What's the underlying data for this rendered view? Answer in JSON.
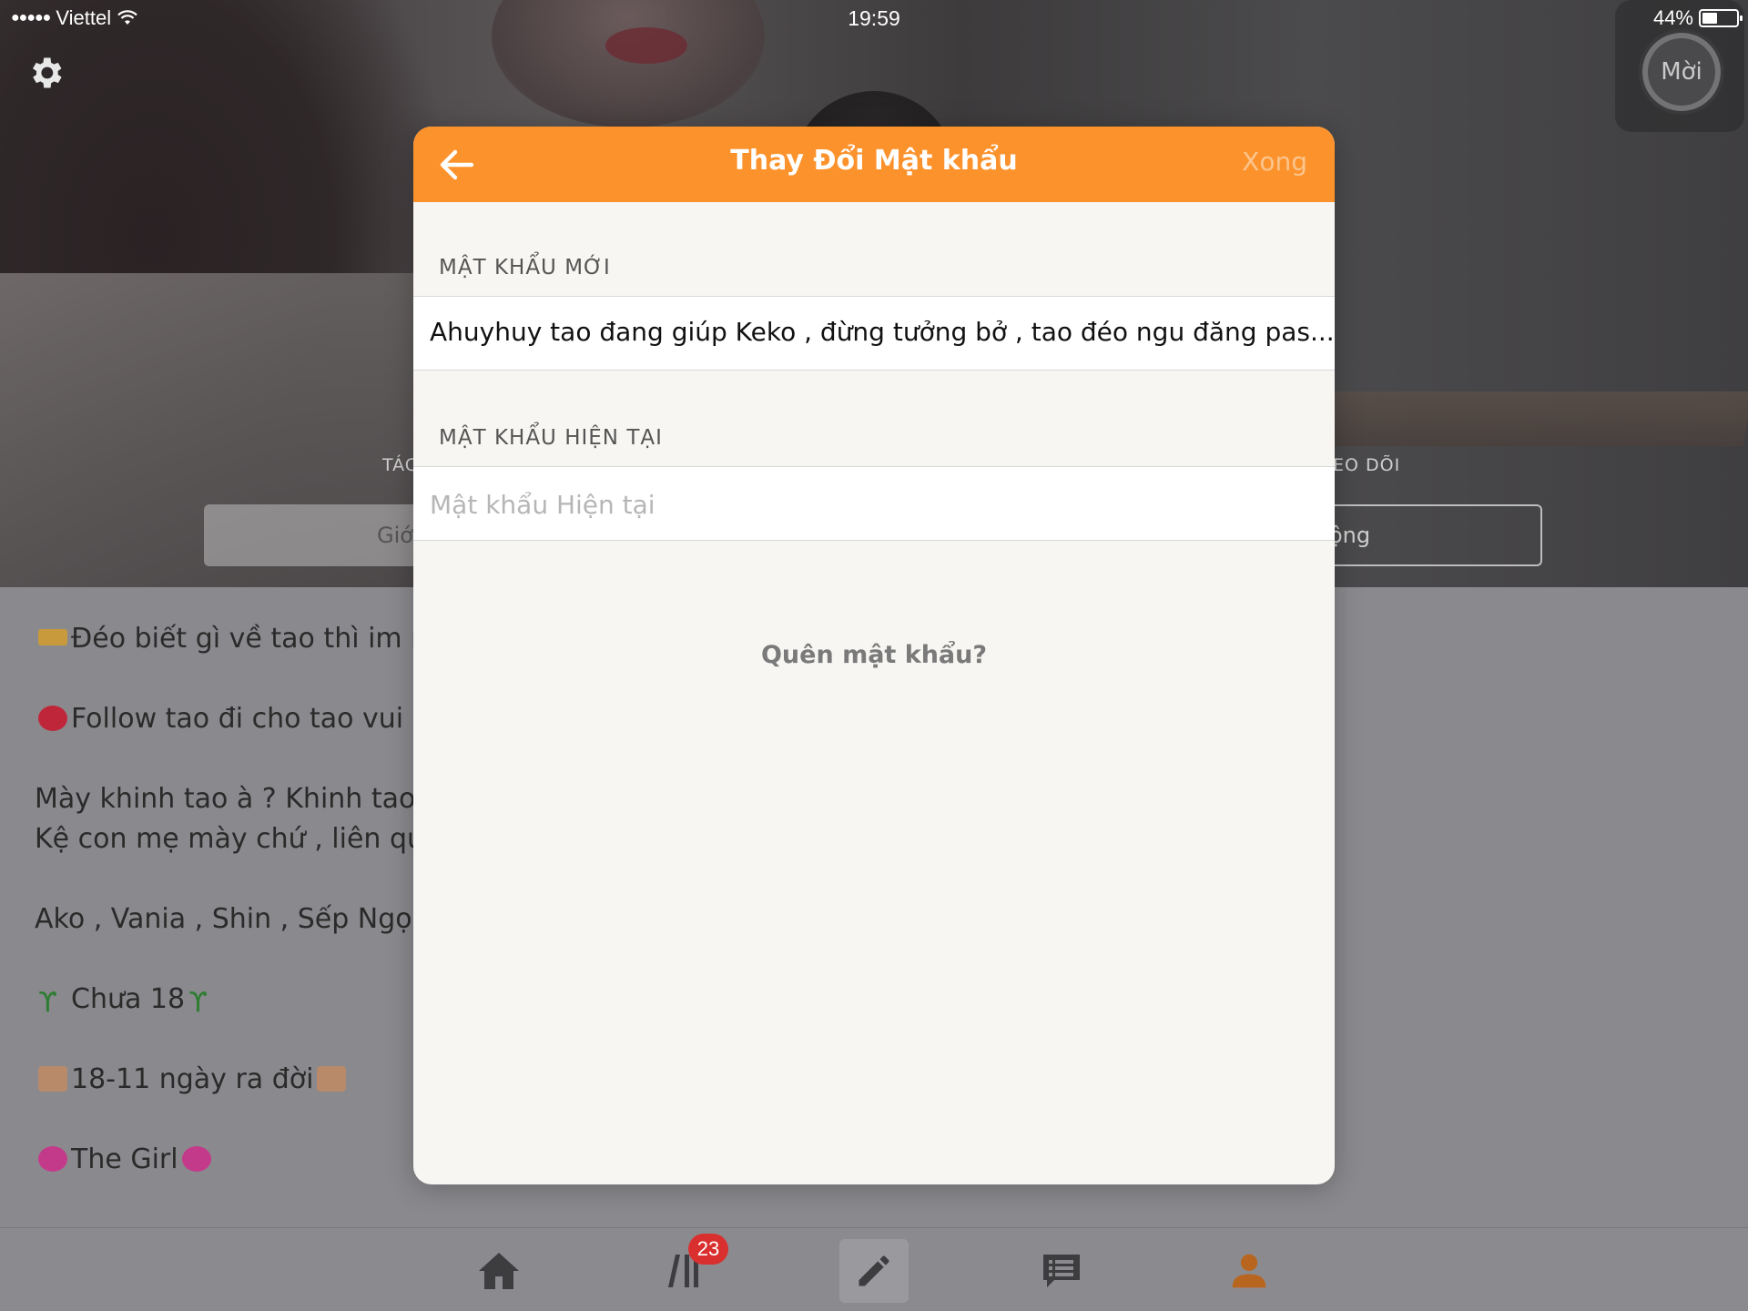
{
  "status_bar": {
    "carrier": "Viettel",
    "time": "19:59",
    "battery": "44%"
  },
  "profile": {
    "invite_label": "Mời",
    "stat_left_label": "TÁC",
    "stat_right_label": "EO DÕI",
    "button_left_label": "Giớ",
    "button_right_label": "ộng",
    "bio_lines": [
      "Đéo biết gì về tao thì im m",
      "Follow tao đi cho tao vui",
      "Mày khinh tao à ? Khinh tao à",
      "Kệ con mẹ mày chứ , liên quan",
      "Ako , Vania , Shin , Sếp Ngọc là",
      "Chưa 18",
      "18-11 ngày ra đời",
      "The Girl"
    ]
  },
  "tabbar": {
    "library_badge": "23",
    "tabs": [
      "home-icon",
      "library-icon",
      "write-icon",
      "messages-icon",
      "profile-icon"
    ]
  },
  "modal": {
    "title": "Thay Đổi Mật khẩu",
    "done_label": "Xong",
    "new_password_label": "MẬT KHẨU MỚI",
    "new_password_value": "Ahuyhuy tao đang giúp Keko , đừng tưởng bở , tao đéo ngu đăng pas...",
    "current_password_label": "MẬT KHẨU HIỆN TẠI",
    "current_password_placeholder": "Mật khẩu Hiện tại",
    "forgot_label": "Quên mật khẩu?"
  },
  "colors": {
    "accent": "#fc922c",
    "done_disabled": "#fcc58d",
    "badge": "#d9302f"
  }
}
